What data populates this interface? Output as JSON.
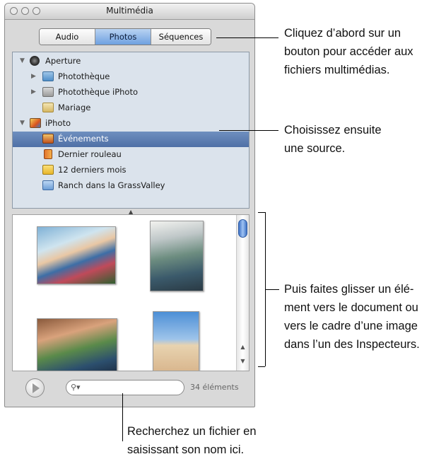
{
  "window": {
    "title": "Multimédia",
    "tabs": [
      {
        "label": "Audio",
        "active": false
      },
      {
        "label": "Photos",
        "active": true
      },
      {
        "label": "Séquences",
        "active": false
      }
    ]
  },
  "sources": {
    "aperture": {
      "label": "Aperture",
      "icon": "aperture-icon"
    },
    "phototheque": {
      "label": "Photothèque",
      "icon": "library-icon"
    },
    "phototheque_iphoto": {
      "label": "Photothèque iPhoto",
      "icon": "library-icon"
    },
    "mariage": {
      "label": "Mariage",
      "icon": "album-icon"
    },
    "iphoto": {
      "label": "iPhoto",
      "icon": "iphoto-icon"
    },
    "evenements": {
      "label": "Événements",
      "icon": "events-icon",
      "selected": true
    },
    "dernier_rouleau": {
      "label": "Dernier rouleau",
      "icon": "roll-icon"
    },
    "douze_mois": {
      "label": "12 derniers mois",
      "icon": "folder-icon"
    },
    "ranch": {
      "label": "Ranch dans la GrassValley",
      "icon": "album-icon"
    }
  },
  "browser": {
    "item_count": "34 éléments",
    "search_value": ""
  },
  "callouts": {
    "tabs": [
      "Cliquez d’abord sur un",
      "bouton pour accéder aux",
      "fichiers multimédias."
    ],
    "source": [
      "Choisissez ensuite",
      "une source."
    ],
    "drag": [
      "Puis faites glisser un élé-",
      "ment vers le document ou",
      "vers le cadre d’une image",
      "dans l’un des Inspecteurs."
    ],
    "search": [
      "Recherchez un fichier en",
      "saisissant son nom ici."
    ]
  },
  "colors": {
    "selection": "#5676ab",
    "segment_active": "#6ea0e0",
    "sourcelist_bg": "#dbe3ec",
    "scroll_knob": "#3f73c6"
  }
}
